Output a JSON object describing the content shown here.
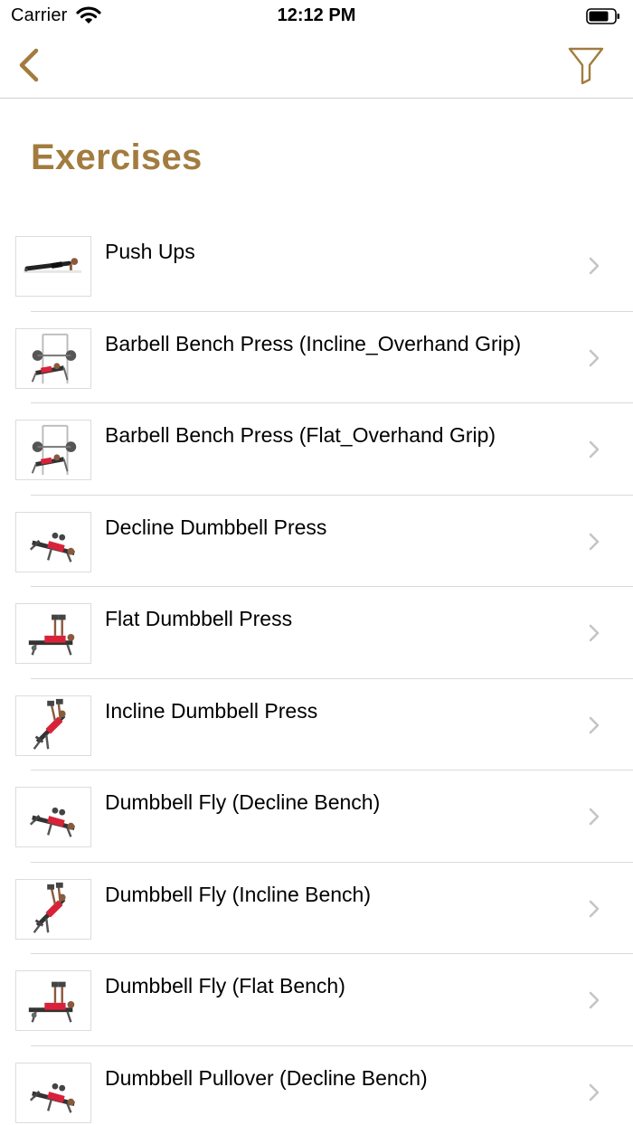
{
  "status": {
    "carrier": "Carrier",
    "time": "12:12 PM",
    "wifi_icon": "wifi-icon",
    "battery_icon": "battery-icon"
  },
  "nav": {
    "back_icon": "chevron-left-icon",
    "filter_icon": "filter-icon",
    "accent": "#a27c3f"
  },
  "page": {
    "title": "Exercises"
  },
  "exercises": [
    {
      "label": "Push Ups",
      "thumb": "pushup"
    },
    {
      "label": "Barbell Bench Press (Incline_Overhand Grip)",
      "thumb": "rack"
    },
    {
      "label": "Barbell Bench Press (Flat_Overhand Grip)",
      "thumb": "rack"
    },
    {
      "label": "Decline Dumbbell Press",
      "thumb": "decline"
    },
    {
      "label": "Flat Dumbbell Press",
      "thumb": "flat"
    },
    {
      "label": "Incline Dumbbell Press",
      "thumb": "incline"
    },
    {
      "label": "Dumbbell Fly (Decline Bench)",
      "thumb": "decline"
    },
    {
      "label": "Dumbbell Fly (Incline Bench)",
      "thumb": "incline"
    },
    {
      "label": "Dumbbell Fly (Flat Bench)",
      "thumb": "flat"
    },
    {
      "label": "Dumbbell Pullover (Decline Bench)",
      "thumb": "decline"
    }
  ]
}
